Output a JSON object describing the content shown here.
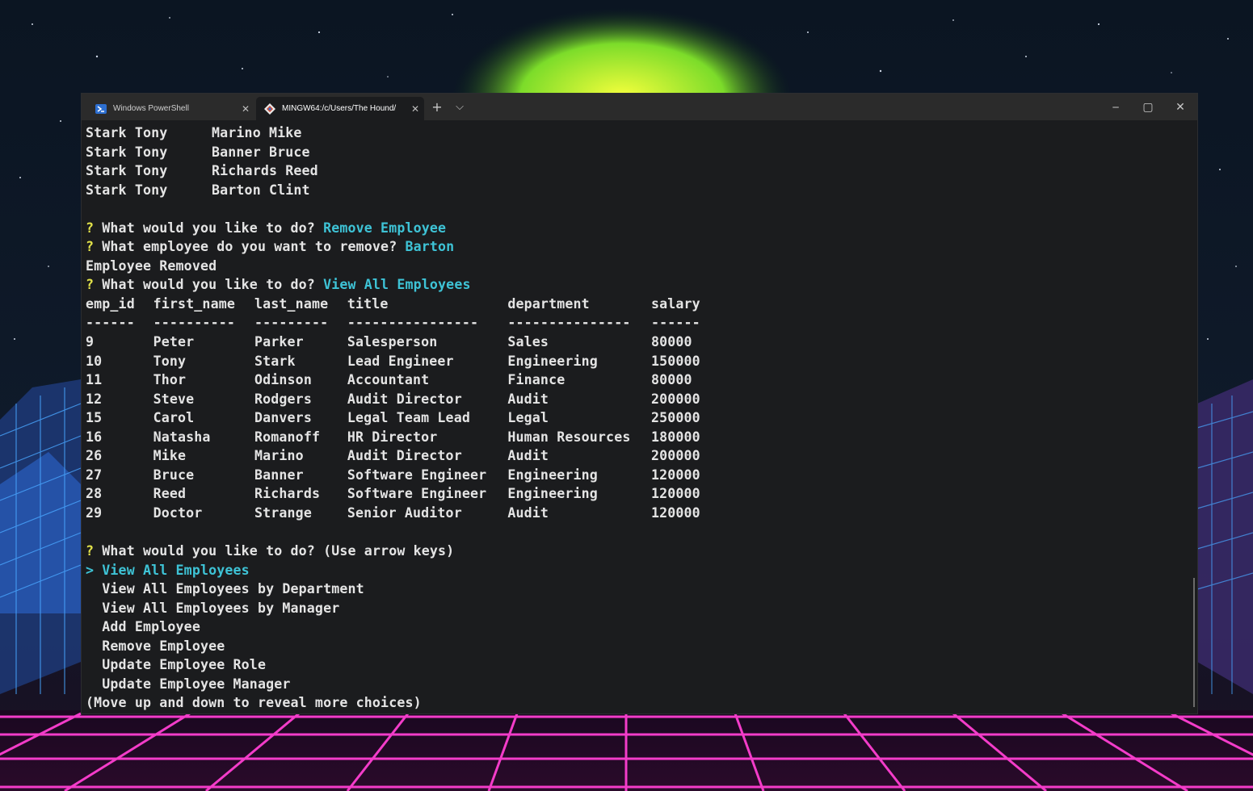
{
  "tabs": [
    {
      "label": "Windows PowerShell",
      "icon": "powershell-icon",
      "active": false
    },
    {
      "label": "MINGW64:/c/Users/The Hound/",
      "icon": "git-bash-icon",
      "active": true
    }
  ],
  "new_tab_symbol": "+",
  "dropdown_symbol": "⌵",
  "window_controls": {
    "minimize": "─",
    "maximize": "▢",
    "close": "✕"
  },
  "terminal": {
    "prompt_marker": "?",
    "pointer": ">",
    "managers_rows": [
      [
        "Stark Tony",
        "Marino Mike"
      ],
      [
        "Stark Tony",
        "Banner Bruce"
      ],
      [
        "Stark Tony",
        "Richards Reed"
      ],
      [
        "Stark Tony",
        "Barton Clint"
      ]
    ],
    "q1": {
      "question": "What would you like to do?",
      "answer": "Remove Employee"
    },
    "q2": {
      "question": "What employee do you want to remove?",
      "answer": "Barton"
    },
    "removed_msg": "Employee Removed",
    "q3": {
      "question": "What would you like to do?",
      "answer": "View All Employees"
    },
    "table": {
      "headers": [
        "emp_id",
        "first_name",
        "last_name",
        "title",
        "department",
        "salary"
      ],
      "separators": [
        "------",
        "----------",
        "---------",
        "----------------",
        "---------------",
        "------"
      ],
      "rows": [
        [
          "9",
          "Peter",
          "Parker",
          "Salesperson",
          "Sales",
          "80000"
        ],
        [
          "10",
          "Tony",
          "Stark",
          "Lead Engineer",
          "Engineering",
          "150000"
        ],
        [
          "11",
          "Thor",
          "Odinson",
          "Accountant",
          "Finance",
          "80000"
        ],
        [
          "12",
          "Steve",
          "Rodgers",
          "Audit Director",
          "Audit",
          "200000"
        ],
        [
          "15",
          "Carol",
          "Danvers",
          "Legal Team Lead",
          "Legal",
          "250000"
        ],
        [
          "16",
          "Natasha",
          "Romanoff",
          "HR Director",
          "Human Resources",
          "180000"
        ],
        [
          "26",
          "Mike",
          "Marino",
          "Audit Director",
          "Audit",
          "200000"
        ],
        [
          "27",
          "Bruce",
          "Banner",
          "Software Engineer",
          "Engineering",
          "120000"
        ],
        [
          "28",
          "Reed",
          "Richards",
          "Software Engineer",
          "Engineering",
          "120000"
        ],
        [
          "29",
          "Doctor",
          "Strange",
          "Senior Auditor",
          "Audit",
          "120000"
        ]
      ]
    },
    "q4": {
      "question": "What would you like to do?",
      "hint": "(Use arrow keys)"
    },
    "menu": [
      "View All Employees",
      "View All Employees by Department",
      "View All Employees by Manager",
      "Add Employee",
      "Remove Employee",
      "Update Employee Role",
      "Update Employee Manager"
    ],
    "footer": "(Move up and down to reveal more choices)"
  }
}
